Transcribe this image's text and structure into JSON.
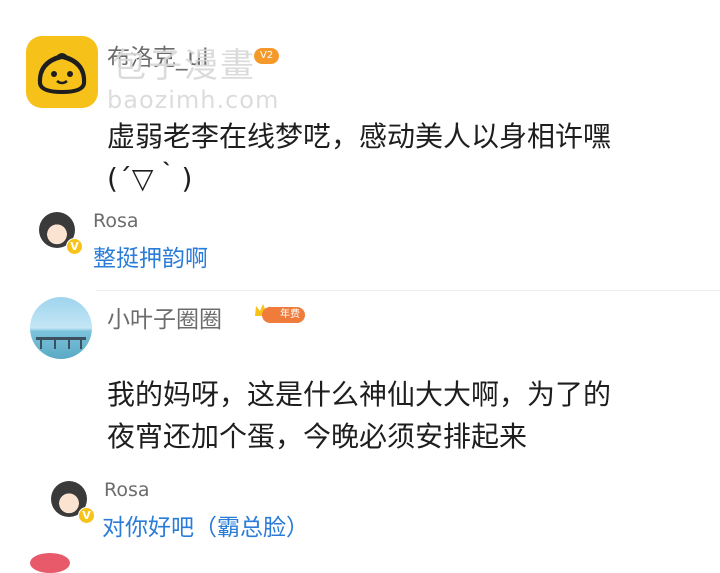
{
  "watermark": {
    "text": "包子漫畫",
    "url": "baozimh.com"
  },
  "comments": [
    {
      "username": "布洛克_ul",
      "level": "V2",
      "avatar": "steamed-bun-icon",
      "lines": [
        "虚弱老李在线梦呓，感动美人以身相许嘿",
        "(´▽｀)"
      ]
    },
    {
      "username": "小叶子圈圈",
      "badge": "年费",
      "avatar": "seaside-pier-photo",
      "lines": [
        "我的妈呀，这是什么神仙大大啊，为了的",
        "夜宵还加个蛋，今晚必须安排起来"
      ]
    }
  ],
  "replies": [
    {
      "username": "Rosa",
      "badge": "V",
      "text": "整挺押韵啊"
    },
    {
      "username": "Rosa",
      "badge": "V",
      "text": "对你好吧（霸总脸）"
    }
  ],
  "colors": {
    "reply_link": "#2b7cd8",
    "username": "#6c6c6c",
    "vip": "#f7c31a"
  }
}
